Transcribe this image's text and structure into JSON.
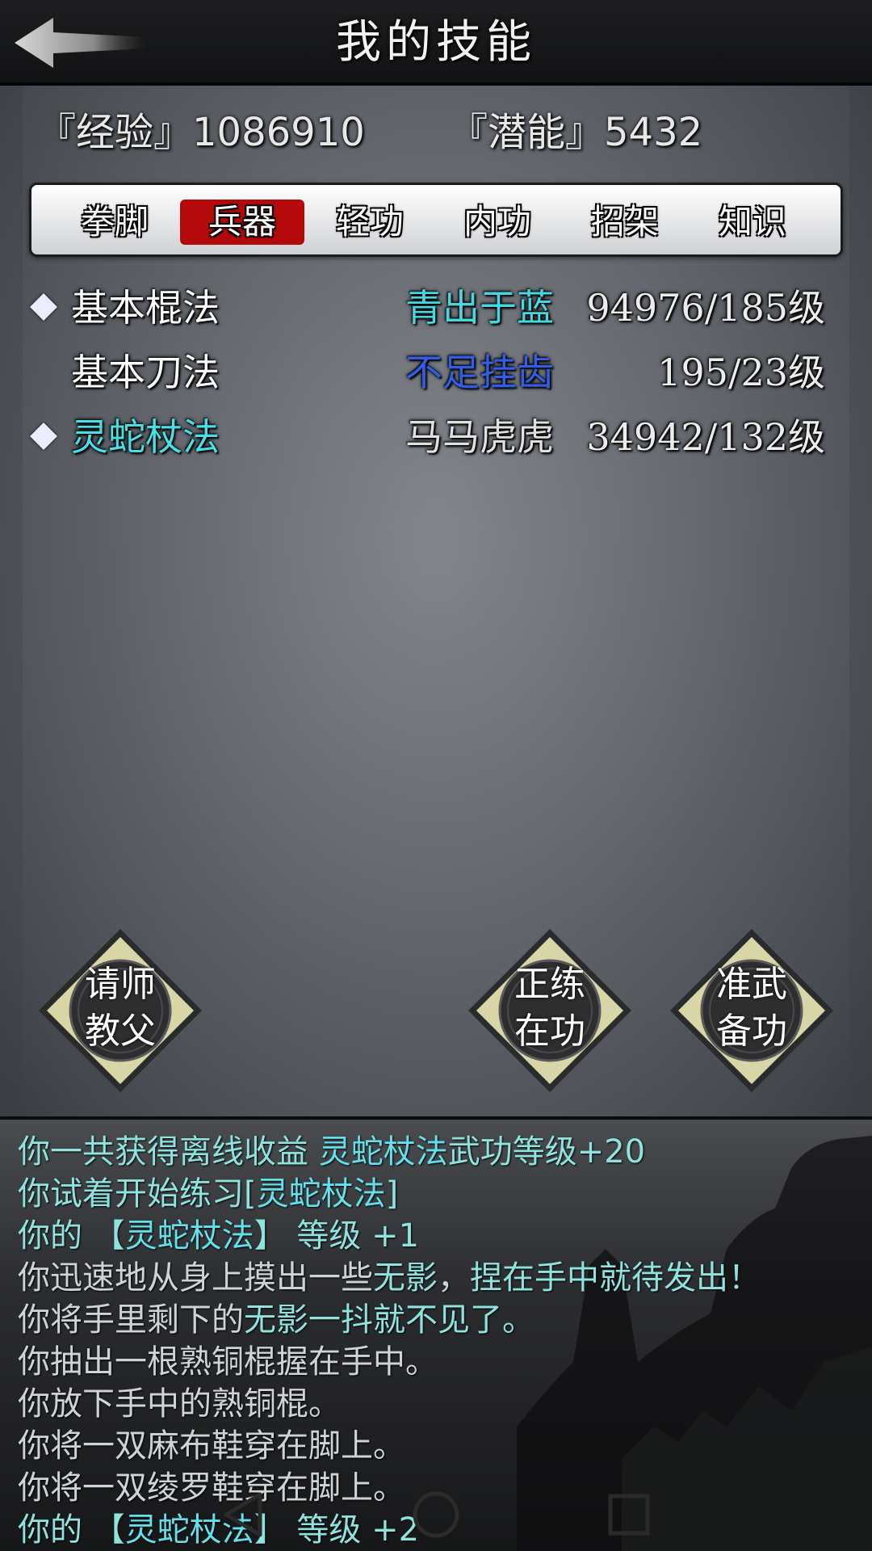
{
  "header": {
    "title": "我的技能"
  },
  "stats": {
    "experience": "『经验』1086910",
    "potential": "『潜能』5432"
  },
  "tabs": [
    {
      "label": "拳脚"
    },
    {
      "label": "兵器"
    },
    {
      "label": "轻功"
    },
    {
      "label": "内功"
    },
    {
      "label": "招架"
    },
    {
      "label": "知识"
    }
  ],
  "active_tab": 1,
  "skills": [
    {
      "name": "基本棍法",
      "grade": "青出于蓝",
      "level": "94976/185级",
      "marked": true
    },
    {
      "name": "基本刀法",
      "grade": "不足挂齿",
      "level": "195/23级",
      "marked": false
    },
    {
      "name": "灵蛇杖法",
      "grade": "马马虎虎",
      "level": "34942/132级",
      "marked": true
    }
  ],
  "actions": {
    "teacher": {
      "line1": "请师",
      "line2": "教父"
    },
    "practice": {
      "line1": "正练",
      "line2": "在功"
    },
    "prepare": {
      "line1": "准武",
      "line2": "备功"
    }
  },
  "log": [
    {
      "parts": [
        {
          "t": "你一共获得离线收益 ",
          "c": "teal"
        },
        {
          "t": "灵蛇杖法",
          "c": "cyan"
        },
        {
          "t": "武功等级+20",
          "c": "teal"
        }
      ]
    },
    {
      "parts": [
        {
          "t": "你试着开始练习[",
          "c": "teal"
        },
        {
          "t": "灵蛇杖法",
          "c": "cyan"
        },
        {
          "t": "]",
          "c": "teal"
        }
      ]
    },
    {
      "parts": [
        {
          "t": "你的 【",
          "c": "teal"
        },
        {
          "t": "灵蛇杖法",
          "c": "cyan"
        },
        {
          "t": "】 等级 +1",
          "c": "teal"
        }
      ]
    },
    {
      "parts": [
        {
          "t": "你迅速地从身上摸出一些",
          "c": "gray"
        },
        {
          "t": "无影",
          "c": "teal"
        },
        {
          "t": "，",
          "c": "gray"
        },
        {
          "t": "捏在手中就待发出！",
          "c": "teal"
        }
      ]
    },
    {
      "parts": [
        {
          "t": "你将手里剩下的",
          "c": "gray"
        },
        {
          "t": "无影",
          "c": "teal"
        },
        {
          "t": "一抖就不见了。",
          "c": "teal"
        }
      ]
    },
    {
      "parts": [
        {
          "t": "你抽出一根熟铜棍握在手中。",
          "c": "gray"
        }
      ]
    },
    {
      "parts": [
        {
          "t": "你放下手中的熟铜棍。",
          "c": "gray"
        }
      ]
    },
    {
      "parts": [
        {
          "t": "你将一双麻布鞋穿在脚上。",
          "c": "gray"
        }
      ]
    },
    {
      "parts": [
        {
          "t": "你将一双绫罗鞋穿在脚上。",
          "c": "gray"
        }
      ]
    },
    {
      "parts": [
        {
          "t": "你的 【",
          "c": "teal"
        },
        {
          "t": "灵蛇杖法",
          "c": "cyan"
        },
        {
          "t": "】 等级 +2",
          "c": "teal"
        }
      ]
    }
  ],
  "colors": {
    "accent_red": "#b4090b",
    "grade_teal": "#46d8e0",
    "grade_blue": "#2f5fe8",
    "grade_gray": "#e0e0e0",
    "log_teal": "#8fe3df",
    "log_cyan": "#63e1ea"
  },
  "icons": {
    "back": "back-arrow-icon",
    "nav_back": "nav-back-icon",
    "nav_home": "nav-home-icon",
    "nav_recent": "nav-recent-icon"
  }
}
